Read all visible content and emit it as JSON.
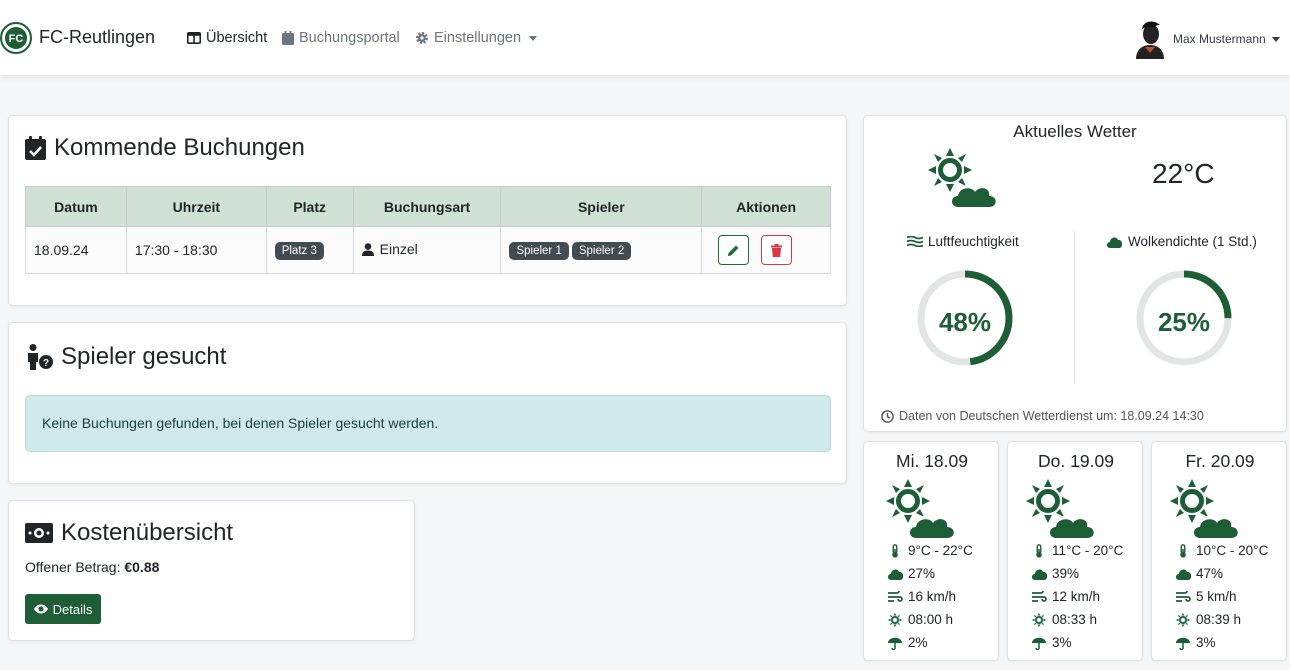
{
  "navbar": {
    "brand": "FC-Reutlingen",
    "items": [
      {
        "label": "Übersicht",
        "icon": "table-columns-icon",
        "active": true
      },
      {
        "label": "Buchungsportal",
        "icon": "calendar-icon"
      },
      {
        "label": "Einstellungen",
        "icon": "gear-icon",
        "dropdown": true
      }
    ],
    "user": "Max Mustermann"
  },
  "bookings": {
    "title": "Kommende Buchungen",
    "columns": [
      "Datum",
      "Uhrzeit",
      "Platz",
      "Buchungsart",
      "Spieler",
      "Aktionen"
    ],
    "rows": [
      {
        "datum": "18.09.24",
        "uhrzeit": "17:30 - 18:30",
        "platz": "Platz 3",
        "art": "Einzel",
        "spieler": [
          "Spieler 1",
          "Spieler 2"
        ]
      }
    ]
  },
  "wanted": {
    "title": "Spieler gesucht",
    "message": "Keine Buchungen gefunden, bei denen Spieler gesucht werden."
  },
  "costs": {
    "title": "Kostenübersicht",
    "label": "Offener Betrag:",
    "amount": "€0.88",
    "button": "Details"
  },
  "weather": {
    "title": "Aktuelles Wetter",
    "temperature": "22°C",
    "humidity_label": "Luftfeuchtigkeit",
    "humidity_value": "48%",
    "humidity_fraction": 0.48,
    "clouds_label": "Wolkendichte (1 Std.)",
    "clouds_value": "25%",
    "clouds_fraction": 0.25,
    "source": "Daten von Deutschen Wetterdienst um: 18.09.24 14:30",
    "accent": "#1d5e36"
  },
  "forecast": [
    {
      "day": "Mi. 18.09",
      "temp": "9°C - 22°C",
      "clouds": "27%",
      "wind": "16 km/h",
      "sun": "08:00 h",
      "rain": "2%"
    },
    {
      "day": "Do. 19.09",
      "temp": "11°C - 20°C",
      "clouds": "39%",
      "wind": "12 km/h",
      "sun": "08:33 h",
      "rain": "3%"
    },
    {
      "day": "Fr. 20.09",
      "temp": "10°C - 20°C",
      "clouds": "47%",
      "wind": "5 km/h",
      "sun": "08:39 h",
      "rain": "3%"
    }
  ]
}
